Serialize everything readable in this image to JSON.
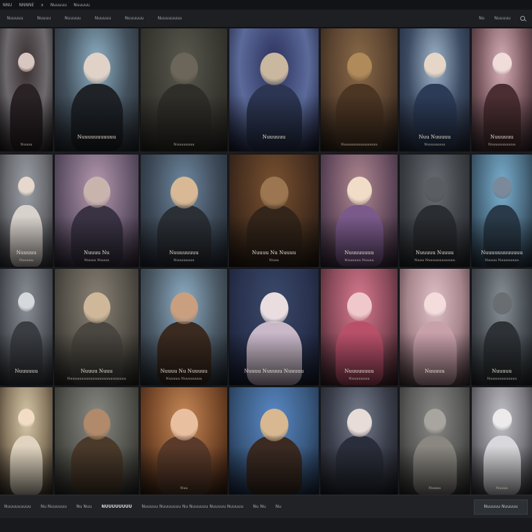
{
  "window": {
    "title_left": "NNU",
    "title_tab": "NNNNE",
    "title_close": "x",
    "title_extra": "Nuuuuu",
    "title_extra2": "Nuuuuu"
  },
  "nav": {
    "items": [
      "Nuuuuu",
      "Nuuuu",
      "Nuuuuu",
      "Nuuuuu",
      "Nuuuuuu",
      "Nuuuuuuuu"
    ],
    "right_label": "Nu",
    "right_label2": "Nuuuuu"
  },
  "cards": [
    {
      "title": "",
      "sub": "Nuuuu",
      "colors": [
        "#3a2f30",
        "#6d6a6e",
        "#1c1719"
      ],
      "figure": "#2a2224",
      "face": "#d8c6c0"
    },
    {
      "title": "Nuuuuuuuuuuu",
      "sub": "",
      "colors": [
        "#8fb3c8",
        "#43505c",
        "#20242a"
      ],
      "figure": "#1f2328",
      "face": "#e1d2c7"
    },
    {
      "title": "",
      "sub": "Nuuuuuuuu",
      "colors": [
        "#5b5a50",
        "#3b3a33",
        "#24231f"
      ],
      "figure": "#2f2e29",
      "face": "#6b6659"
    },
    {
      "title": "Nuuuuuu",
      "sub": "",
      "colors": [
        "#2b2f5a",
        "#5b6a9a",
        "#14162a"
      ],
      "figure": "#2c3652",
      "face": "#c9b79f"
    },
    {
      "title": "",
      "sub": "Nuuuuuuuuuuuuuuu",
      "colors": [
        "#8a6a48",
        "#5a4330",
        "#241a12"
      ],
      "figure": "#4b3523",
      "face": "#b08a5a"
    },
    {
      "title": "Nuu Nuuuuu",
      "sub": "Nuuuuuuuu",
      "colors": [
        "#9fb7cc",
        "#3c4a62",
        "#1b2232"
      ],
      "figure": "#2c3b57",
      "face": "#e6d6c8"
    },
    {
      "title": "Nuuuuuu",
      "sub": "Nuuuuuuuuuuu",
      "colors": [
        "#d8b0b8",
        "#7a5860",
        "#2b1e22"
      ],
      "figure": "#4a2e32",
      "face": "#f0dcd8"
    },
    {
      "title": "Nuuuuu",
      "sub": "Nuuuuu",
      "colors": [
        "#9aa0a7",
        "#6a6b70",
        "#2c2d31"
      ],
      "figure": "#d8d2cc",
      "face": "#e6d8cc"
    },
    {
      "title": "Nuuuu Nu",
      "sub": "Nuuuu Nuuuu",
      "colors": [
        "#b69ab0",
        "#6a5a70",
        "#2a2330"
      ],
      "figure": "#3a3344",
      "face": "#c9b3ad"
    },
    {
      "title": "Nuuuuuuuu",
      "sub": "Nuuuuuuuu",
      "colors": [
        "#6f8aa2",
        "#3e4a58",
        "#1d232b"
      ],
      "figure": "#2b2f36",
      "face": "#d9b995"
    },
    {
      "title": "Nuuuu Nu Nuuuu",
      "sub": "Nuuu",
      "colors": [
        "#7a5230",
        "#4a3120",
        "#1c140e"
      ],
      "figure": "#33251a",
      "face": "#9b7650"
    },
    {
      "title": "Nuuuuuuuu",
      "sub": "Nuuuuuu Nuuuu",
      "colors": [
        "#b08890",
        "#6a4f62",
        "#2a2030"
      ],
      "figure": "#7a5a8a",
      "face": "#f1dcc8"
    },
    {
      "title": "Nuuuuu Nuuuu",
      "sub": "Nuuu Nuuuuuuuuuuuu",
      "colors": [
        "#6c7076",
        "#3e4247",
        "#1e2023"
      ],
      "figure": "#2a2d31",
      "face": "#5a5d61"
    },
    {
      "title": "Nuuuuuuuuuuuu",
      "sub": "Nuuuu Nuuuuuuuu",
      "colors": [
        "#7ab0d0",
        "#4a6a80",
        "#1c2a36"
      ],
      "figure": "#2a3a48",
      "face": "#7a8a9a"
    },
    {
      "title": "Nuuuuuu",
      "sub": "",
      "colors": [
        "#8a8f96",
        "#55595f",
        "#23262a"
      ],
      "figure": "#3a3d42",
      "face": "#d6d9dc"
    },
    {
      "title": "Nuuuu Nuuu",
      "sub": "Nuuuuuuuuuuuuuuuuuuuuuuuuu",
      "colors": [
        "#8a8276",
        "#56524a",
        "#24221e"
      ],
      "figure": "#4a4640",
      "face": "#cfb89a"
    },
    {
      "title": "Nuuuu Nu Nuuuuu",
      "sub": "Nuuuuu Nuuuuuuuu",
      "colors": [
        "#8fb0c8",
        "#4c5a66",
        "#1e252b"
      ],
      "figure": "#3a2a20",
      "face": "#c99f7f"
    },
    {
      "title": "Nuuuu Nuuuuu Nuuuuu",
      "sub": "",
      "colors": [
        "#3b4a6a",
        "#2a3350",
        "#14182a"
      ],
      "figure": "#c8b8c8",
      "face": "#eadde0"
    },
    {
      "title": "Nuuuuuuuu",
      "sub": "Nuuuuuuuu",
      "colors": [
        "#d87a8f",
        "#8a4a5a",
        "#2e1a20"
      ],
      "figure": "#b8506a",
      "face": "#f0c8cc"
    },
    {
      "title": "Nuuuuu",
      "sub": "",
      "colors": [
        "#e0c0c8",
        "#a8868e",
        "#3a2c30"
      ],
      "figure": "#c8a0aa",
      "face": "#f4dcdc"
    },
    {
      "title": "Nuuuuu",
      "sub": "Nuuuuuuuuuuuu",
      "colors": [
        "#8a9298",
        "#4a5056",
        "#1e2226"
      ],
      "figure": "#2e3236",
      "face": "#6a6e72"
    },
    {
      "title": "",
      "sub": "",
      "colors": [
        "#d8c8a8",
        "#8a7a62",
        "#2e281e"
      ],
      "figure": "#e0d4c0",
      "face": "#f2ddc4"
    },
    {
      "title": "",
      "sub": "",
      "colors": [
        "#8a8a86",
        "#55554f",
        "#22221e"
      ],
      "figure": "#4a3a2a",
      "face": "#b08a6a"
    },
    {
      "title": "",
      "sub": "Nuu",
      "colors": [
        "#c88a58",
        "#7a4a2a",
        "#2a180e"
      ],
      "figure": "#5a3a2a",
      "face": "#e8c0a0"
    },
    {
      "title": "",
      "sub": "",
      "colors": [
        "#5a8ac8",
        "#3a5a80",
        "#18243a"
      ],
      "figure": "#3a2a22",
      "face": "#d8b890"
    },
    {
      "title": "",
      "sub": "",
      "colors": [
        "#7a8090",
        "#3a3e4a",
        "#181a20"
      ],
      "figure": "#2a2e3a",
      "face": "#e8dcd8"
    },
    {
      "title": "",
      "sub": "Nuuuu",
      "colors": [
        "#8a8a88",
        "#5a5a58",
        "#252523"
      ],
      "figure": "#8a8680",
      "face": "#a8a49e"
    },
    {
      "title": "",
      "sub": "Nuuuu",
      "colors": [
        "#c0c0c6",
        "#7a7a80",
        "#2a2a2e"
      ],
      "figure": "#d8d8dc",
      "face": "#eceaea"
    }
  ],
  "bottombar": {
    "items": [
      "Nuuuuuuuuu",
      "Nu Nuuuuuu",
      "Nu Nuu",
      "NUUUUUUUU",
      "Nuuuuu Nuuuuuuu Nu Nuuuuuu Nuuuuu Nuuuuu",
      "Nu Nu",
      "Nu"
    ],
    "button_label": "Nuuuuu Nuuuuu"
  }
}
